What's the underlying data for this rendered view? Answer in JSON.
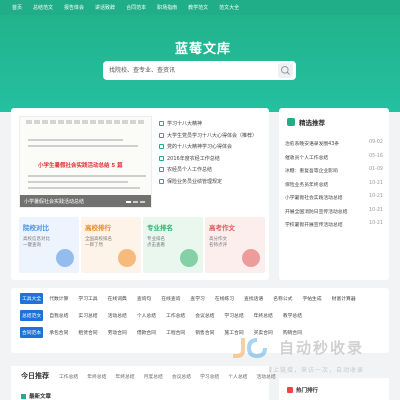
{
  "nav": [
    "首页",
    "总结范文",
    "报告体会",
    "讲话致辞",
    "合同范本",
    "职场指南",
    "教学范文",
    "范文大全"
  ],
  "site": {
    "logo": "蓝莓文库"
  },
  "search": {
    "placeholder": "找院校、查专业、查资讯"
  },
  "slide": {
    "title": "小学生暑假社会实践活动总结 5 篇",
    "caption": "小学暑假社会实践活动总结"
  },
  "news": [
    "学习十八大精神",
    "大学生党员学习十八大心得体会（推荐）",
    "党的十八大精神学习心得体会",
    "2016年度农经工作总结",
    "农经员个人工作总结",
    "保险业务员业绩管理规定"
  ],
  "categories": [
    {
      "title": "院校对比",
      "desc": [
        "高校信息对比",
        "一键查询"
      ],
      "color": "#4a90e2",
      "bg": "#eef4fd"
    },
    {
      "title": "高校排行",
      "desc": [
        "全国高校排名",
        "一目了然"
      ],
      "color": "#f08a24",
      "bg": "#fdf3e8"
    },
    {
      "title": "专业排名",
      "desc": [
        "专业排名",
        "点击查看"
      ],
      "color": "#2fb36e",
      "bg": "#eaf7ef"
    },
    {
      "title": "高考作文",
      "desc": [
        "高分作文",
        "名师点评"
      ],
      "color": "#e05a5a",
      "bg": "#fdeeee"
    }
  ],
  "recommend": {
    "title": "精选推荐",
    "items": [
      {
        "text": "治愈系晚安语录发圈43条",
        "date": "09-02"
      },
      {
        "text": "催收员个人工作总结",
        "date": "05-16"
      },
      {
        "text": "冰糖：重复吾等企业影响",
        "date": "01-09"
      },
      {
        "text": "保险业务员年终总结",
        "date": "10-21"
      },
      {
        "text": "小学暑假社会实践活动总结",
        "date": "10-21"
      },
      {
        "text": "开展全国消防日宣传活动总结",
        "date": "10-21"
      },
      {
        "text": "学校暑假开展宣传活动总结",
        "date": "10-21"
      }
    ]
  },
  "tags": [
    {
      "label": "工具大全",
      "items": [
        "代数计算",
        "学习工具",
        "在线词典",
        "查询句",
        "在线查询",
        "查学习",
        "在线练习",
        "查找话语",
        "名称公式",
        "字帖生成",
        "财富计算器",
        "在线编辑",
        "名片"
      ]
    },
    {
      "label": "总结范文",
      "items": [
        "自我总结",
        "实习总结",
        "活动总结",
        "个人总结",
        "工作总结",
        "会议总结",
        "学习总结",
        "年终总结",
        "教学总结",
        "工作总结"
      ]
    },
    {
      "label": "合同范本",
      "items": [
        "承包合同",
        "租赁合同",
        "劳动合同",
        "借款合同",
        "工程合同",
        "销售合同",
        "施工合同",
        "买卖合同",
        "购销合同"
      ]
    }
  ],
  "watermark": {
    "title": "自动秒收录",
    "sub": "做上链接，来访一次，自动收录"
  },
  "today": {
    "title": "今日推荐",
    "filters": [
      "工作总结",
      "年终总结",
      "年终总结",
      "月度总结",
      "会议总结",
      "学习总结",
      "个人总结",
      "活动总结"
    ]
  },
  "latest": {
    "title": "最新文章"
  },
  "hot": {
    "title": "热门排行"
  }
}
